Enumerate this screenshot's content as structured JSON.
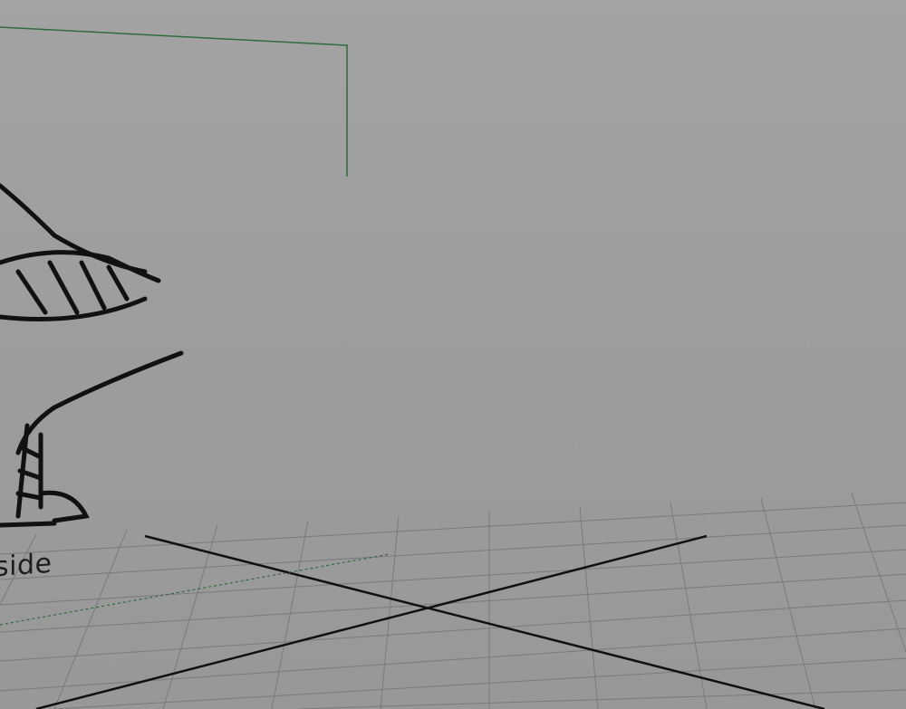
{
  "viewport": {
    "camera_label": "side",
    "background_color": "#9d9d9d",
    "grid_color": "#7c7c7c",
    "axis_color": "#111111",
    "wireframe_color": "#1a1aa0",
    "mesh_color": "#5a5a5e",
    "image_plane_border_color": "#2f6b3a"
  }
}
